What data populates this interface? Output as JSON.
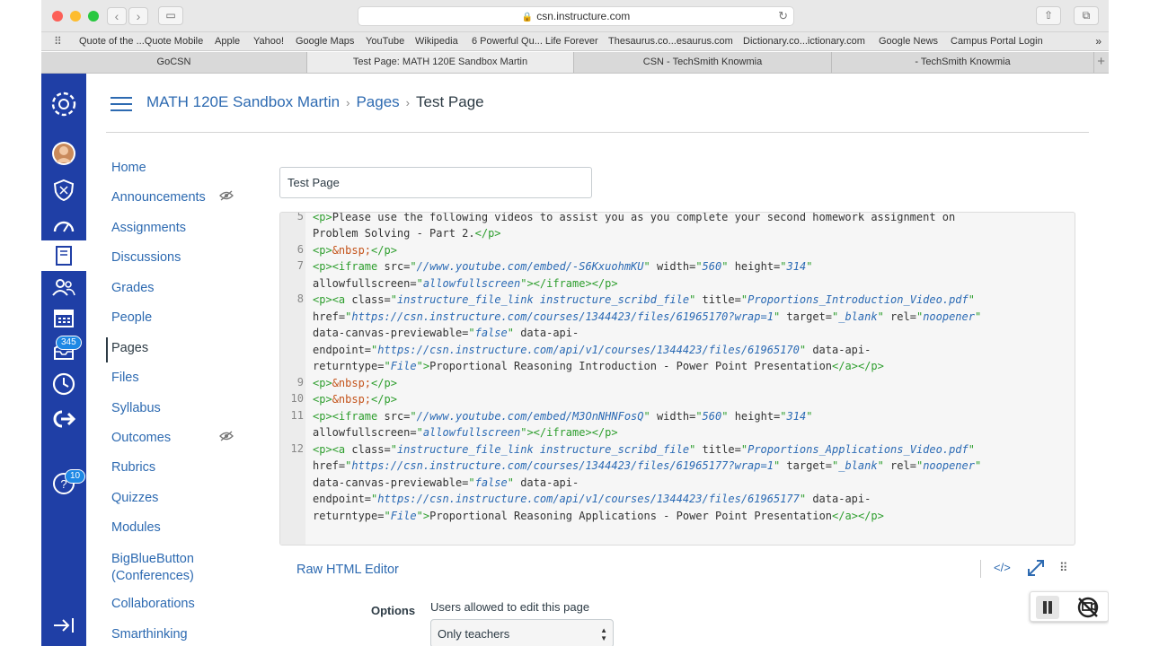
{
  "browser": {
    "url": "csn.instructure.com",
    "favorites": [
      "Quote of the ...Quote Mobile",
      "Apple",
      "Yahoo!",
      "Google Maps",
      "YouTube",
      "Wikipedia",
      "6 Powerful Qu... Life Forever",
      "Thesaurus.co...esaurus.com",
      "Dictionary.co...ictionary.com",
      "Google News",
      "Campus Portal Login"
    ],
    "tabs": [
      {
        "label": "GoCSN",
        "active": false
      },
      {
        "label": "Test Page: MATH 120E Sandbox Martin",
        "active": true
      },
      {
        "label": "CSN - TechSmith Knowmia",
        "active": false
      },
      {
        "label": "- TechSmith Knowmia",
        "active": false
      }
    ]
  },
  "global_nav": {
    "inbox_badge": "345",
    "help_badge": "10"
  },
  "breadcrumb": {
    "course": "MATH 120E Sandbox Martin",
    "section": "Pages",
    "current": "Test Page"
  },
  "course_nav": [
    {
      "label": "Home"
    },
    {
      "label": "Announcements",
      "hidden": true
    },
    {
      "label": "Assignments"
    },
    {
      "label": "Discussions"
    },
    {
      "label": "Grades"
    },
    {
      "label": "People"
    },
    {
      "label": "Pages",
      "active": true
    },
    {
      "label": "Files"
    },
    {
      "label": "Syllabus"
    },
    {
      "label": "Outcomes",
      "hidden": true
    },
    {
      "label": "Rubrics"
    },
    {
      "label": "Quizzes"
    },
    {
      "label": "Modules"
    },
    {
      "label": "BigBlueButton (Conferences)"
    },
    {
      "label": "Collaborations"
    },
    {
      "label": "Smarthinking"
    }
  ],
  "page_title_input": "Test Page",
  "editor": {
    "line_numbers": [
      "5",
      "6",
      "7",
      "8",
      "9",
      "10",
      "11",
      "12"
    ],
    "lines": [
      "<p>Please use the following videos to assist you as you complete your second homework assignment on",
      "Problem Solving - Part 2.</p>",
      "<p>&nbsp;</p>",
      "<p><iframe src=\"//www.youtube.com/embed/-S6KxuohmKU\" width=\"560\" height=\"314\"",
      "allowfullscreen=\"allowfullscreen\"></iframe></p>",
      "<p><a class=\"instructure_file_link instructure_scribd_file\" title=\"Proportions_Introduction_Video.pdf\"",
      "href=\"https://csn.instructure.com/courses/1344423/files/61965170?wrap=1\" target=\"_blank\" rel=\"noopener\"",
      "data-canvas-previewable=\"false\" data-api-",
      "endpoint=\"https://csn.instructure.com/api/v1/courses/1344423/files/61965170\" data-api-",
      "returntype=\"File\">Proportional Reasoning Introduction - Power Point Presentation</a></p>",
      "<p>&nbsp;</p>",
      "<p>&nbsp;</p>",
      "<p><iframe src=\"//www.youtube.com/embed/M3OnNHNFosQ\" width=\"560\" height=\"314\"",
      "allowfullscreen=\"allowfullscreen\"></iframe></p>",
      "<p><a class=\"instructure_file_link instructure_scribd_file\" title=\"Proportions_Applications_Video.pdf\"",
      "href=\"https://csn.instructure.com/courses/1344423/files/61965177?wrap=1\" target=\"_blank\" rel=\"noopener\"",
      "data-canvas-previewable=\"false\" data-api-",
      "endpoint=\"https://csn.instructure.com/api/v1/courses/1344423/files/61965177\" data-api-",
      "returntype=\"File\">Proportional Reasoning Applications - Power Point Presentation</a></p>"
    ]
  },
  "raw_html_editor_label": "Raw HTML Editor",
  "html_toggle_label": "</>",
  "options": {
    "label": "Options",
    "edit_permission_label": "Users allowed to edit this page",
    "edit_permission_value": "Only teachers"
  },
  "colors": {
    "canvas_blue": "#1f3fa6",
    "link": "#2d6ab1",
    "text": "#2d3b45"
  }
}
